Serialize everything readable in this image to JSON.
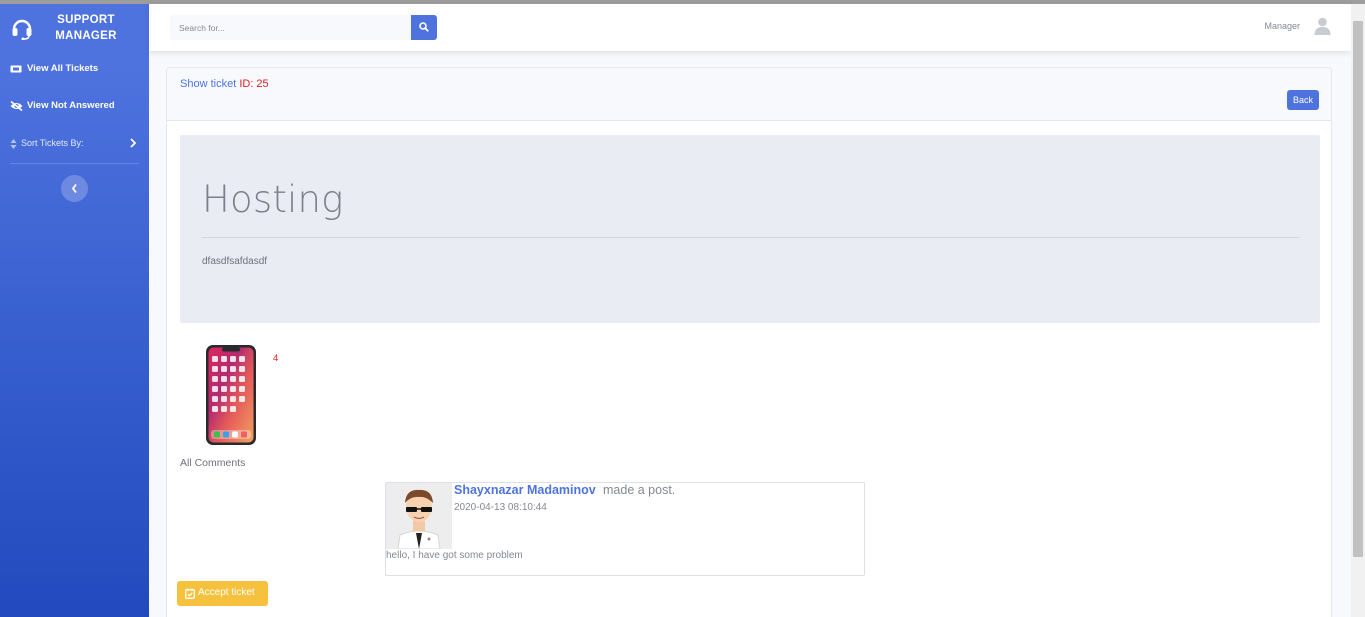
{
  "brand": {
    "line1": "SUPPORT",
    "line2": "MANAGER",
    "icon": "headset-icon"
  },
  "sidebar": {
    "items": [
      {
        "label": "View All Tickets",
        "icon": "ticket-icon"
      },
      {
        "label": "View Not Answered",
        "icon": "eye-slash-icon"
      },
      {
        "label": "Sort Tickets By:",
        "icon": "sort-icon"
      }
    ],
    "toggle_icon": "chevron-left-icon"
  },
  "topbar": {
    "search_placeholder": "Search for...",
    "search_icon": "search-icon",
    "user_name": "Manager",
    "user_icon": "user-icon"
  },
  "card": {
    "title_prefix": "Show ticket ",
    "title_id": "ID: 25",
    "back_label": "Back"
  },
  "ticket": {
    "subject": "Hosting",
    "description": "dfasdfsafdasdf",
    "image": "smartphone-image",
    "count": "4"
  },
  "comments": {
    "heading": "All Comments",
    "items": [
      {
        "author": "Shayxnazar Madaminov",
        "action": "made a post.",
        "date": "2020-04-13 08:10:44",
        "body": "hello, I have got some problem"
      }
    ]
  },
  "accept_label": "Accept ticket",
  "colors": {
    "primary": "#4e73df",
    "warning": "#f6c23e",
    "danger": "#e02020",
    "jumbotron": "#e9ecf3"
  }
}
